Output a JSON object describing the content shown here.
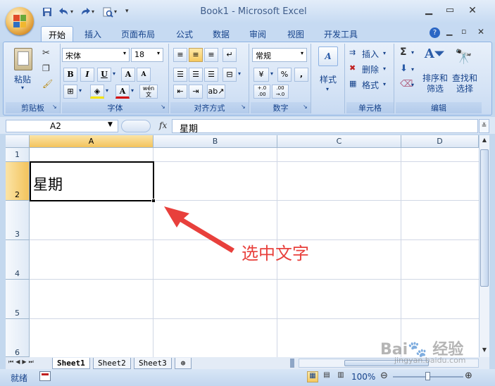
{
  "app": {
    "title": "Book1 - Microsoft Excel",
    "colors": {
      "accent": "#15428b",
      "selection": "#f6c95e",
      "annotation": "#e8403c"
    }
  },
  "quick_access": {
    "icons": [
      "save-icon",
      "undo-icon",
      "redo-icon",
      "print-preview-icon",
      "customize-icon"
    ]
  },
  "tabs": [
    {
      "label": "开始",
      "active": true
    },
    {
      "label": "插入"
    },
    {
      "label": "页面布局"
    },
    {
      "label": "公式"
    },
    {
      "label": "数据"
    },
    {
      "label": "审阅"
    },
    {
      "label": "视图"
    },
    {
      "label": "开发工具"
    }
  ],
  "ribbon": {
    "clipboard": {
      "label": "剪贴板",
      "paste": "粘贴"
    },
    "font": {
      "label": "字体",
      "name": "宋体",
      "size": "18",
      "bold": "B",
      "italic": "I",
      "underline": "U",
      "grow": "A",
      "shrink": "A",
      "font_color": "A",
      "phonetic": "wén"
    },
    "align": {
      "label": "对齐方式"
    },
    "number": {
      "label": "数字",
      "format": "常规",
      "percent": "%",
      "comma": ",",
      "inc": "+.0\n.00",
      "dec": ".00\n→.0"
    },
    "styles": {
      "label": "样式"
    },
    "cells": {
      "label": "单元格",
      "insert": "插入",
      "delete": "删除",
      "format": "格式"
    },
    "editing": {
      "label": "编辑",
      "sort": "排序和\n筛选",
      "find": "查找和\n选择"
    }
  },
  "formula_bar": {
    "name_box": "A2",
    "fx": "fx",
    "value": "星期"
  },
  "columns": [
    "A",
    "B",
    "C",
    "D"
  ],
  "rows": [
    "1",
    "2",
    "3",
    "4",
    "5",
    "6"
  ],
  "cells": {
    "A2": "星期"
  },
  "annotation": "选中文字",
  "sheets": [
    "Sheet1",
    "Sheet2",
    "Sheet3"
  ],
  "status": {
    "mode": "就绪",
    "zoom": "100%"
  },
  "watermark": "Bai du 经验 jingyan.baidu.com"
}
